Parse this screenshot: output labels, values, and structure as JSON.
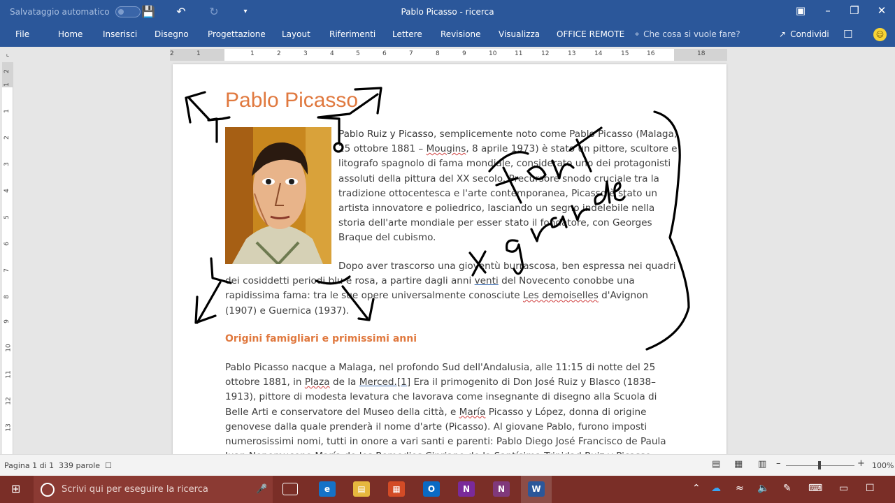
{
  "titlebar": {
    "autosave_label": "Salvataggio automatico",
    "title": "Pablo Picasso - ricerca"
  },
  "ribbon": {
    "tabs": [
      "File",
      "Home",
      "Inserisci",
      "Disegno",
      "Progettazione",
      "Layout",
      "Riferimenti",
      "Lettere",
      "Revisione",
      "Visualizza",
      "OFFICE REMOTE"
    ],
    "tell_me": "Che cosa si vuole fare?",
    "share": "Condividi"
  },
  "ruler": {
    "h_numbers": [
      "2",
      "1",
      "1",
      "2",
      "3",
      "4",
      "5",
      "6",
      "7",
      "8",
      "9",
      "10",
      "11",
      "12",
      "13",
      "14",
      "15",
      "16",
      "18"
    ],
    "v_numbers": [
      "2",
      "1",
      "1",
      "2",
      "3",
      "4",
      "5",
      "6",
      "7",
      "8",
      "9",
      "10",
      "11",
      "12",
      "13"
    ]
  },
  "document": {
    "title": "Pablo Picasso",
    "p1_strong": "Pablo Ruiz y Picasso",
    "p1_a": ", semplicemente noto come Pablo Picasso (Malaga, 25 ottobre 1881 – ",
    "p1_mougins": "Mougins",
    "p1_b": ", 8 aprile 1973) è stato un pittore, scultore e litografo spagnolo di fama mondiale, considerato uno dei protagonisti assoluti della pittura del XX secolo. Precursore snodo cruciale tra la tradizione ottocentesca e l'arte contemporanea, Picasso è stato un artista innovatore e poliedrico, lasciando un segno indelebile nella storia dell'arte mondiale per esser stato il fondatore, con Georges Braque del cubismo.",
    "p2_a": "Dopo aver trascorso una gioventù burrascosa, ben espressa nei quadri dei cosiddetti periodi blu e rosa, a partire dagli anni ",
    "p2_venti": "venti",
    "p2_b": " del Novecento conobbe una rapidissima fama: tra le sue opere universalmente conosciute ",
    "p2_demo": "Les demoiselles",
    "p2_c": " d'Avignon (1907) e Guernica (1937).",
    "heading": "Origini famigliari e primissimi anni",
    "p3_a": "Pablo Picasso nacque a Malaga, nel profondo Sud dell'Andalusia, alle 11:15 di notte del 25 ottobre 1881, in ",
    "p3_plaza": "Plaza",
    "p3_b": " de la ",
    "p3_merced": "Merced.[1]",
    "p3_c": " Era il primogenito di Don José Ruiz y Blasco (1838–1913), pittore di modesta levatura che lavorava come insegnante di disegno alla Scuola di Belle Arti e conservatore del Museo della città, e ",
    "p3_maria": "María",
    "p3_d": " Picasso y López, donna di origine genovese dalla quale prenderà il nome d'arte (Picasso). Al giovane Pablo, furono imposti numerosissimi nomi, tutti in onore a vari santi e parenti: Pablo Diego José Francisco de Paula Juan Nepomuceno María de los Remedios Cipriano de la Santísima Trinidad Ruiz y Picasso."
  },
  "statusbar": {
    "page": "Pagina 1 di 1",
    "words": "339 parole",
    "zoom": "100%"
  },
  "taskbar": {
    "search_placeholder": "Scrivi qui per eseguire la ricerca"
  },
  "colors": {
    "ribbon": "#2b579a",
    "heading": "#e0793f",
    "taskbar": "#7a2e27"
  }
}
